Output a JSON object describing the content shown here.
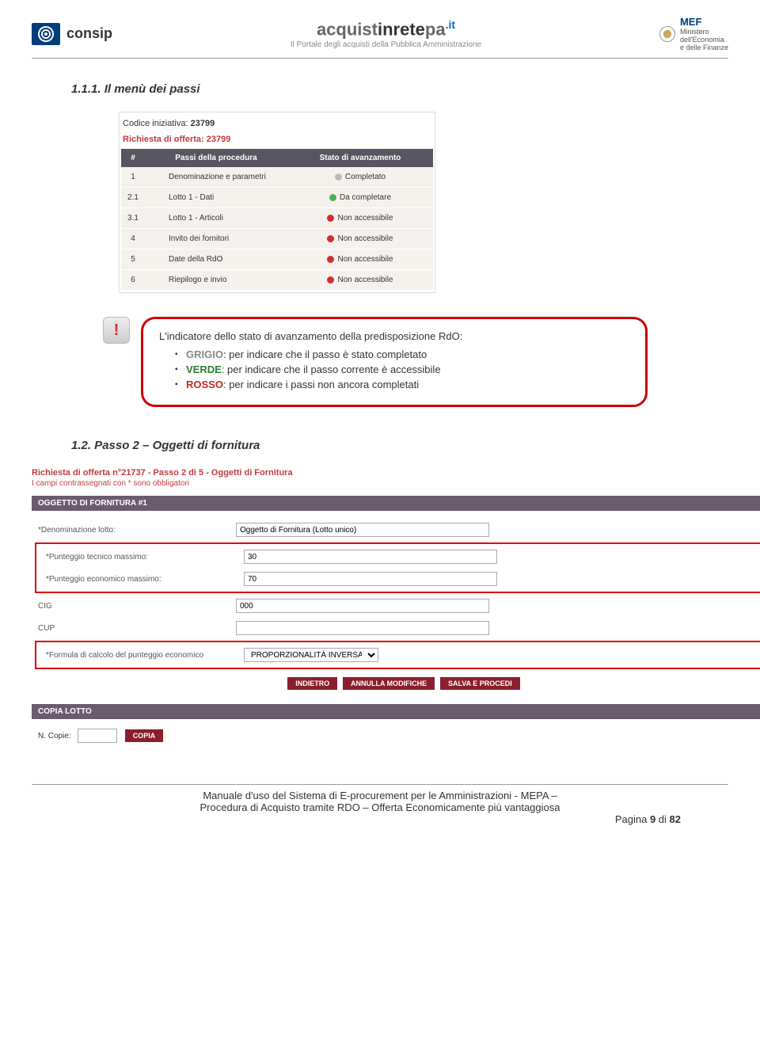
{
  "header": {
    "consip_text": "consip",
    "center_pre": "acquist",
    "center_bold": "inrete",
    "center_post": "pa",
    "center_it": ".it",
    "center_sub": "Il Portale degli acquisti della Pubblica Amministrazione",
    "mef_brand": "MEF",
    "mef_line1": "Ministero",
    "mef_line2": "dell'Economia",
    "mef_line3": "e delle Finanze"
  },
  "section1": {
    "title": "1.1.1. Il menù dei passi"
  },
  "ss1": {
    "codice_label": "Codice iniziativa:",
    "codice_value": "23799",
    "richiesta": "Richiesta di offerta: 23799",
    "th1": "#",
    "th2": "Passi della procedura",
    "th3": "Stato di avanzamento",
    "rows": [
      {
        "n": "1",
        "name": "Denominazione e parametri",
        "status": "Completato",
        "dot": "gray"
      },
      {
        "n": "2.1",
        "name": "Lotto 1 - Dati",
        "status": "Da completare",
        "dot": "green"
      },
      {
        "n": "3.1",
        "name": "Lotto 1 - Articoli",
        "status": "Non accessibile",
        "dot": "red"
      },
      {
        "n": "4",
        "name": "Invito dei fornitori",
        "status": "Non accessibile",
        "dot": "red"
      },
      {
        "n": "5",
        "name": "Date della RdO",
        "status": "Non accessibile",
        "dot": "red"
      },
      {
        "n": "6",
        "name": "Riepilogo e invio",
        "status": "Non accessibile",
        "dot": "red"
      }
    ]
  },
  "info": {
    "intro": "L'indicatore dello stato di avanzamento della predisposizione RdO:",
    "grigio_label": "GRIGIO",
    "grigio_text": ": per indicare che il passo è stato completato",
    "verde_label": "VERDE",
    "verde_text": ": per indicare che il passo corrente è accessibile",
    "rosso_label": "ROSSO",
    "rosso_text": ": per indicare i passi non ancora completati"
  },
  "section2": {
    "title": "1.2.    Passo 2 – Oggetti di fornitura"
  },
  "ss2": {
    "title": "Richiesta di offerta n°21737 - Passo 2 di 5 - Oggetti di Fornitura",
    "note": "I campi contrassegnati con * sono obbligatori",
    "help": "?",
    "bar1": "OGGETTO DI FORNITURA #1",
    "label_denom": "*Denominazione lotto:",
    "val_denom": "Oggetto di Fornitura (Lotto unico)",
    "label_tec": "*Punteggio tecnico massimo:",
    "val_tec": "30",
    "label_eco": "*Punteggio economico massimo:",
    "val_eco": "70",
    "label_cig": "CIG",
    "val_cig": "000",
    "label_cup": "CUP",
    "val_cup": "",
    "label_formula": "*Formula di calcolo del punteggio economico",
    "val_formula": "PROPORZIONALITÀ INVERSA",
    "btn_indietro": "INDIETRO",
    "btn_annulla": "ANNULLA MODIFICHE",
    "btn_salva": "SALVA E PROCEDI",
    "bar2": "COPIA LOTTO",
    "copie_label": "N. Copie:",
    "btn_copia": "COPIA"
  },
  "footer": {
    "line1": "Manuale d'uso del Sistema di E-procurement per le Amministrazioni - MEPA –",
    "line2": "Procedura di Acquisto tramite RDO – Offerta Economicamente più vantaggiosa",
    "page_pre": "Pagina ",
    "page_num": "9",
    "page_mid": " di ",
    "page_total": "82"
  }
}
